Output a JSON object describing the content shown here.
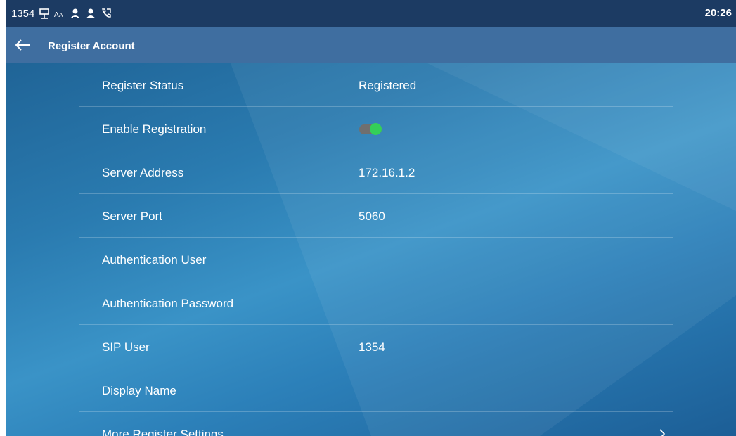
{
  "status_bar": {
    "extension": "1354",
    "time": "20:26",
    "icons": [
      "network-icon",
      "ime-icon",
      "contacts-icon",
      "user-icon",
      "call-forward-icon"
    ]
  },
  "title_bar": {
    "back_icon": "arrow-left-icon",
    "title": "Register Account"
  },
  "settings": {
    "register_status": {
      "label": "Register Status",
      "value": "Registered"
    },
    "enable_registration": {
      "label": "Enable Registration",
      "enabled": true,
      "toggle_color": "#34d058"
    },
    "server_address": {
      "label": "Server Address",
      "value": "172.16.1.2"
    },
    "server_port": {
      "label": "Server Port",
      "value": "5060"
    },
    "authentication_user": {
      "label": "Authentication User",
      "value": ""
    },
    "authentication_password": {
      "label": "Authentication Password",
      "value": ""
    },
    "sip_user": {
      "label": "SIP User",
      "value": "1354"
    },
    "display_name": {
      "label": "Display Name",
      "value": ""
    },
    "more_register_settings": {
      "label": "More Register Settings",
      "icon": "chevron-right-icon"
    }
  },
  "colors": {
    "status_bar_bg": "#1c3b63",
    "title_bar_bg": "#3f6ea0",
    "content_bg": "#2a7bb0"
  }
}
